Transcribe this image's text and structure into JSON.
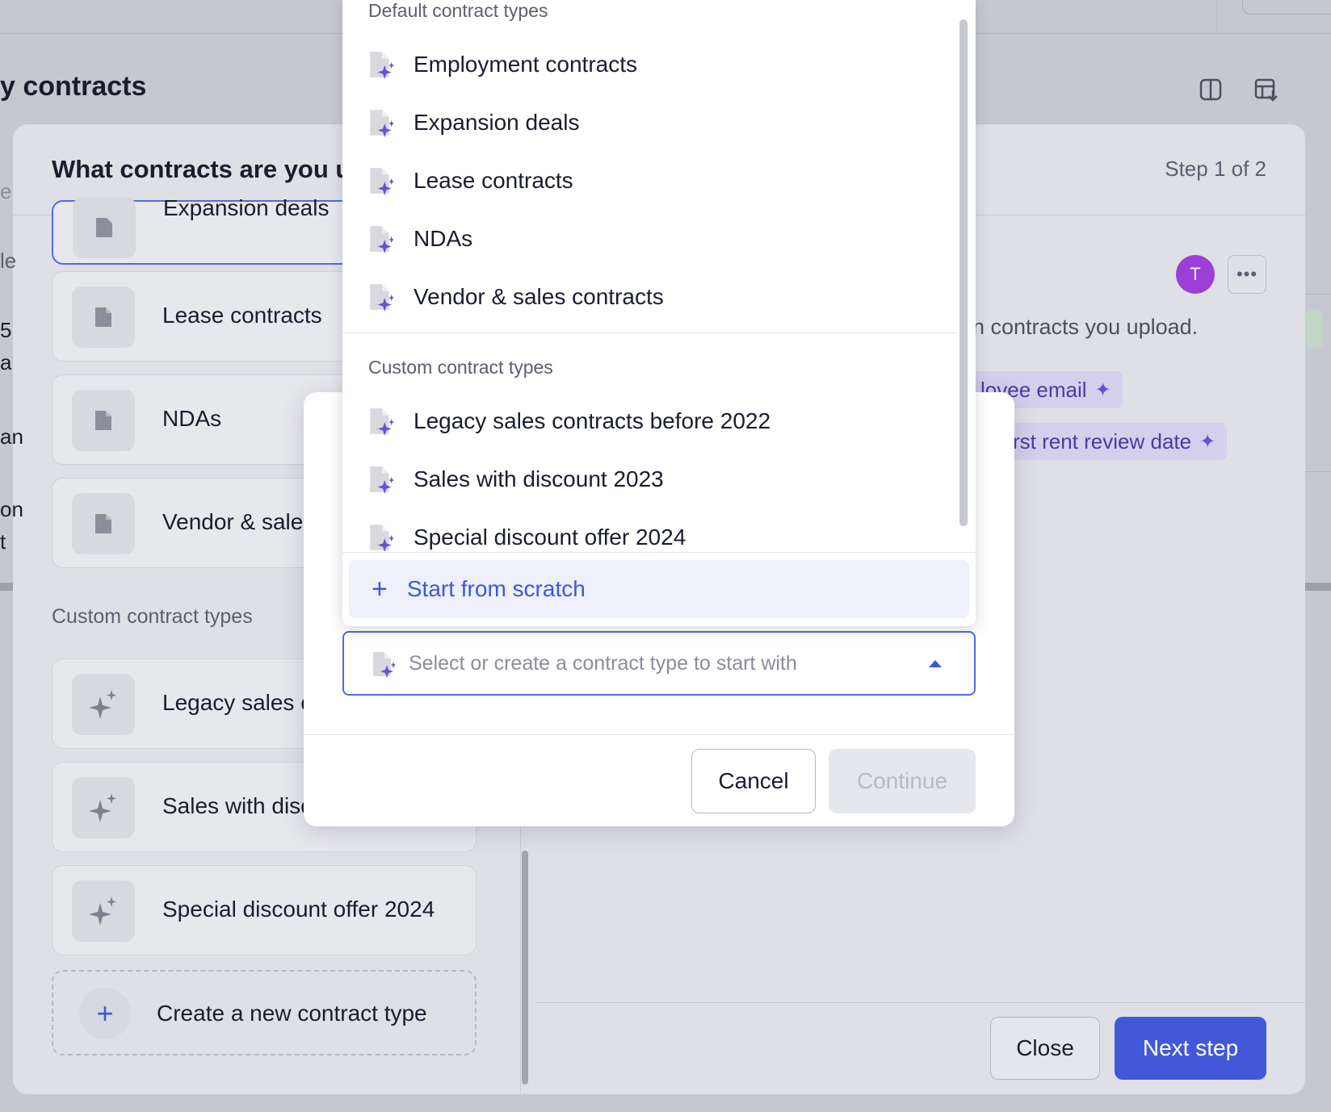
{
  "page": {
    "title": "y contracts",
    "edge_fragments": [
      "e",
      "le",
      "5",
      "a",
      "an",
      "on",
      "t"
    ]
  },
  "wizard": {
    "title": "What contracts are you u",
    "step": "Step 1 of 2",
    "default_types": [
      {
        "label": "Expansion deals",
        "icon": "document-icon",
        "selected": true
      },
      {
        "label": "Lease contracts",
        "icon": "document-icon",
        "selected": false
      },
      {
        "label": "NDAs",
        "icon": "document-icon",
        "selected": false
      },
      {
        "label": "Vendor & sales",
        "icon": "document-icon",
        "selected": false
      }
    ],
    "custom_section_label": "Custom contract types",
    "custom_types": [
      {
        "label": "Legacy sales c",
        "icon": "sparkle-icon"
      },
      {
        "label": "Sales with disc",
        "icon": "sparkle-icon"
      },
      {
        "label": "Special discount offer 2024",
        "icon": "sparkle-icon"
      }
    ],
    "create_label": "Create a new contract type",
    "avatar_initial": "T",
    "more_label": "•••",
    "description": "n contracts you upload.",
    "chips": [
      "lovee email",
      "rst rent review date"
    ],
    "close_label": "Close",
    "next_label": "Next step"
  },
  "modal": {
    "select_placeholder": "Select or create a contract type to start with",
    "cancel_label": "Cancel",
    "continue_label": "Continue"
  },
  "dropdown": {
    "default_group_label": "Default contract types",
    "default_items": [
      "Employment contracts",
      "Expansion deals",
      "Lease contracts",
      "NDAs",
      "Vendor & sales contracts"
    ],
    "custom_group_label": "Custom contract types",
    "custom_items": [
      "Legacy sales contracts before 2022",
      "Sales with discount 2023",
      "Special discount offer 2024"
    ],
    "scratch_label": "Start from scratch"
  },
  "colors": {
    "accent": "#4258d8",
    "avatar": "#9c3fd6",
    "chip_bg": "#d4d0eb",
    "overlay": "#c6c8d1"
  }
}
